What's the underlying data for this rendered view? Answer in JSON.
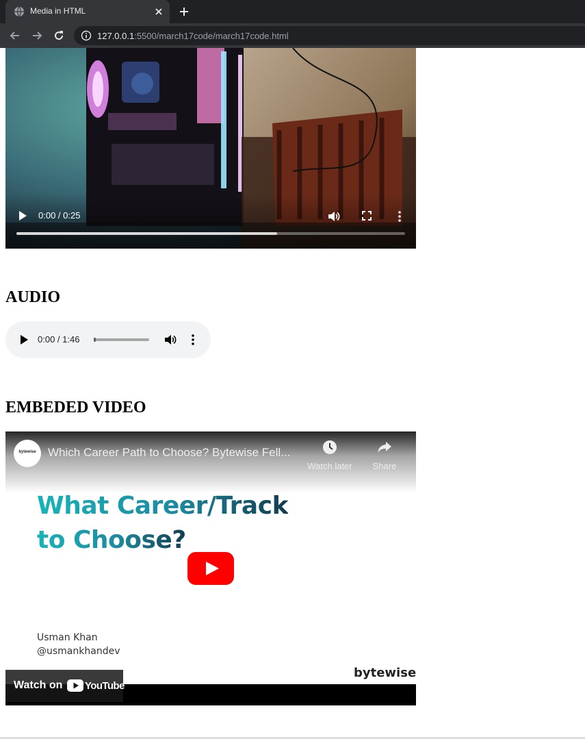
{
  "browser": {
    "tab_title": "Media in HTML",
    "url_host": "127.0.0.1",
    "url_rest": ":5500/march17code/march17code.html"
  },
  "video": {
    "time_display": "0:00 / 0:25",
    "buffered_fraction": 0.67
  },
  "audio_section": {
    "heading": "AUDIO",
    "time_display": "0:00 / 1:46"
  },
  "embed_section": {
    "heading": "EMBEDED VIDEO",
    "channel_avatar_text": "bytewise",
    "title": "Which Career Path to Choose? Bytewise Fell...",
    "watch_later_label": "Watch later",
    "share_label": "Share",
    "thumbnail": {
      "headline_line1": "What Career/Track",
      "headline_line2": "to Choose?",
      "author_name": "Usman Khan",
      "author_handle": "@usmankhandev",
      "brand_name": "bytewise",
      "brand_dot": "."
    },
    "watch_on_label": "Watch on",
    "youtube_wordmark": "YouTube"
  },
  "colors": {
    "chrome_dark": "#202124",
    "chrome_tab": "#35363a",
    "youtube_red": "#ff0000",
    "headline_teal": "#18b4b8",
    "brand_dot": "#e53935"
  },
  "icons": {
    "tab": "globe-icon",
    "close": "close-icon",
    "new_tab": "plus-icon",
    "back": "back-arrow-icon",
    "forward": "forward-arrow-icon",
    "reload": "reload-icon",
    "site_info": "info-icon",
    "play": "play-icon",
    "volume": "volume-icon",
    "fullscreen": "fullscreen-icon",
    "more": "more-vert-icon",
    "watch_later": "clock-icon",
    "share": "share-icon",
    "youtube": "youtube-logo-icon"
  }
}
